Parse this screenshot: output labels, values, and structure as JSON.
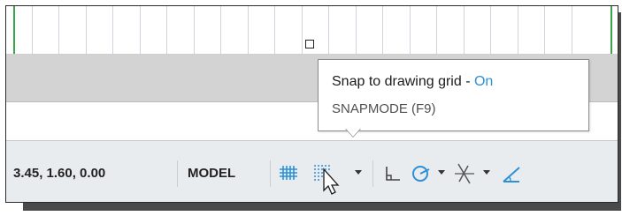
{
  "canvas": {
    "grid_color": "#cfd4dc",
    "axis_color": "#3aa64a"
  },
  "tooltip": {
    "title": "Snap to drawing grid - ",
    "state": "On",
    "state_color": "#2d8fd6",
    "command": "SNAPMODE (F9)"
  },
  "statusbar": {
    "coordinates": "3.45, 1.60, 0.00",
    "space": "MODEL",
    "buttons": [
      {
        "name": "grid-display",
        "icon": "grid-icon"
      },
      {
        "name": "snap-mode",
        "icon": "snap-grid-icon"
      },
      {
        "name": "ortho",
        "icon": "ortho-icon"
      },
      {
        "name": "polar",
        "icon": "polar-tracking-icon"
      },
      {
        "name": "isodraft",
        "icon": "isometric-icon"
      },
      {
        "name": "object-snap-tracking",
        "icon": "object-snap-tracking-icon"
      }
    ],
    "accent": "#2d8fd6"
  }
}
